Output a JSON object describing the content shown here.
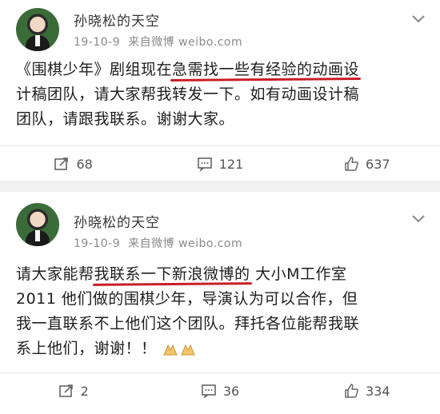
{
  "posts": [
    {
      "username": "孙晓松的天空",
      "date": "19-10-9",
      "source": "来自微博 weibo.com",
      "content_lines": [
        [
          "《围棋少年》剧组现在",
          "急需找一些有经验的动画设",
          ""
        ],
        [
          "计稿团队，请大家帮我转发一下。如有动画设计稿",
          "",
          ""
        ],
        [
          "团队，请跟我联系。谢谢大家。",
          "",
          ""
        ]
      ],
      "repost_count": "68",
      "comment_count": "121",
      "like_count": "637"
    },
    {
      "username": "孙晓松的天空",
      "date": "19-10-9",
      "source": "来自微博 weibo.com",
      "content_lines": [
        [
          "请大家能帮",
          "我联系一下新浪微博的",
          "大小M工作室"
        ],
        [
          "2011 他们做的围棋少年，导演认为可以合作，但",
          "",
          ""
        ],
        [
          "我一直联系不上他们这个团队。拜托各位能帮我联",
          "",
          ""
        ],
        [
          "系上他们，谢谢！！",
          "",
          ""
        ]
      ],
      "repost_count": "2",
      "comment_count": "36",
      "like_count": "334"
    }
  ],
  "colors": {
    "highlight_underline": "#c81e28",
    "meta_text": "#8a8a8a",
    "background": "#f2f2f2"
  },
  "icons": {
    "repost": "repost-icon",
    "comment": "comment-icon",
    "like": "thumbs-up-icon",
    "menu": "chevron-down-icon",
    "emoji": "folded-hands-emoji"
  }
}
